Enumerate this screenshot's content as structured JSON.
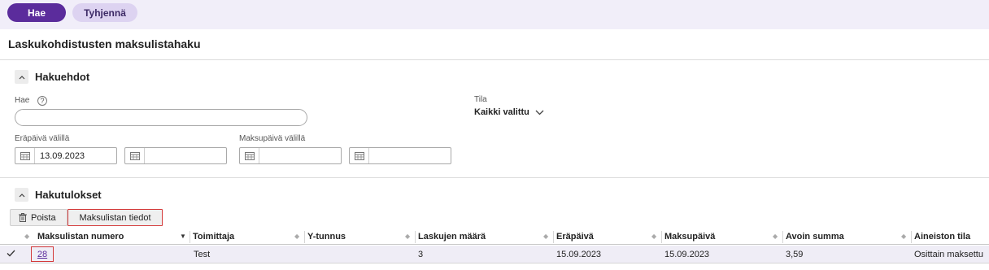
{
  "topbar": {
    "search_button": "Hae",
    "clear_button": "Tyhjennä"
  },
  "page": {
    "title": "Laskukohdistusten maksulistahaku"
  },
  "criteria": {
    "title": "Hakuehdot",
    "search_label": "Hae",
    "help_glyph": "?",
    "search_value": "",
    "due_date_label": "Eräpäivä välillä",
    "due_date_from": "13.09.2023",
    "due_date_to": "",
    "payment_date_label": "Maksupäivä välillä",
    "payment_date_from": "",
    "payment_date_to": "",
    "status_label": "Tila",
    "status_value": "Kaikki valittu"
  },
  "results": {
    "title": "Hakutulokset",
    "delete_button": "Poista",
    "details_button": "Maksulistan tiedot",
    "columns": [
      "Maksulistan numero",
      "Toimittaja",
      "Y-tunnus",
      "Laskujen määrä",
      "Eräpäivä",
      "Maksupäivä",
      "Avoin summa",
      "Aineiston tila"
    ],
    "rows": [
      {
        "number": "28",
        "supplier": "Test",
        "business_id": "",
        "invoice_count": "3",
        "due_date": "15.09.2023",
        "payment_date": "15.09.2023",
        "open_amount": "3,59",
        "status": "Osittain maksettu"
      }
    ]
  },
  "colors": {
    "accent": "#5b2c9c",
    "accent_light": "#ddd3f1",
    "topbar_bg": "#f1eef9",
    "highlight_border": "#d43a3a",
    "row_bg": "#efedf6"
  }
}
